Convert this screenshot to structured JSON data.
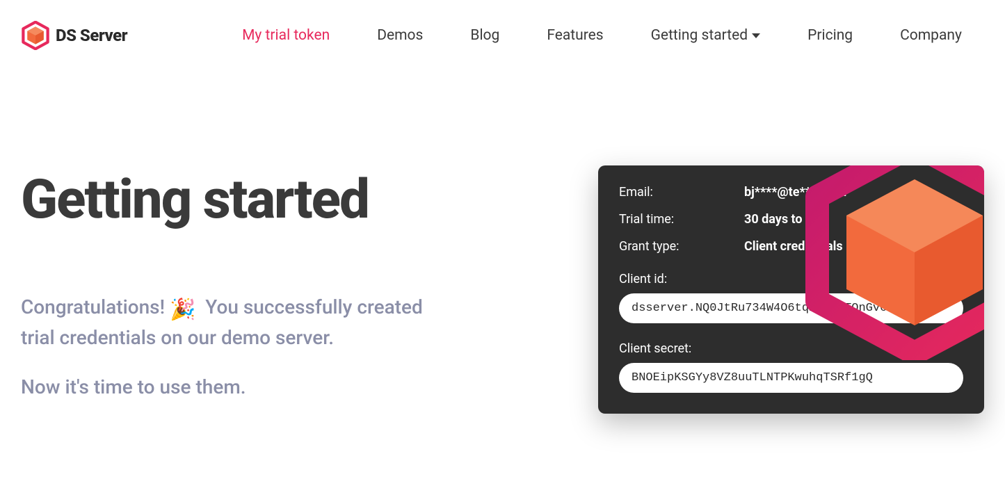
{
  "brand": {
    "name": "DS Server"
  },
  "nav": {
    "trial": "My trial token",
    "demos": "Demos",
    "blog": "Blog",
    "features": "Features",
    "getting_started": "Getting started",
    "pricing": "Pricing",
    "company": "Company"
  },
  "page": {
    "title": "Getting started",
    "congrats_prefix": "Congratulations!",
    "congrats_rest1": "You successfully created",
    "congrats_rest2": "trial credentials on our demo server.",
    "now": "Now it's time to use them."
  },
  "card": {
    "email_label": "Email:",
    "email_value": "bj****@te****com",
    "trial_label": "Trial time:",
    "trial_value": "30 days to go",
    "grant_label": "Grant type:",
    "grant_value": "Client credentials",
    "grant_help": "[?]",
    "client_id_label": "Client id:",
    "client_id_value": "dsserver.NQ0JtRu734W4O6tqiDSkrTOnGv62auEw",
    "client_secret_label": "Client secret:",
    "client_secret_value": "BNOEipKSGYy8VZ8uuTLNTPKwuhqTSRf1gQ"
  },
  "colors": {
    "accent": "#e7295c",
    "orange": "#f26a3d"
  }
}
